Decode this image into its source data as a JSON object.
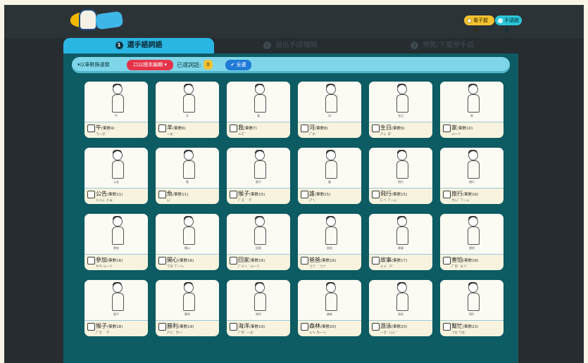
{
  "tabs": [
    {
      "num": "1",
      "label": "選手語詞語"
    },
    {
      "num": "2",
      "label": "選出手語種類"
    },
    {
      "num": "3",
      "label": "預覽/下載學手語"
    }
  ],
  "header": {
    "pill_a": "電子握手",
    "pill_b": "手語圖畫"
  },
  "filter": {
    "sort_label": "▾以筆數篩選類",
    "stroke_label": "口以總本編輯 ▾",
    "count_label": "已選詞語:",
    "count_value": "0",
    "select_all_label": "✔ 全選"
  },
  "cards": [
    {
      "caption": "牛",
      "word": "牛",
      "strokes": "(筆數4)",
      "zhuyin": "ㄋ一ㄡˊ"
    },
    {
      "caption": "羊",
      "word": "羊",
      "strokes": "(筆數6)",
      "zhuyin": "一ㄤˊ"
    },
    {
      "caption": "我",
      "word": "我",
      "strokes": "(筆數7)",
      "zhuyin": "ㄨㄛˇ"
    },
    {
      "caption": "河",
      "word": "河",
      "strokes": "(筆數8)",
      "zhuyin": "ㄏㄜˊ"
    },
    {
      "caption": "生日",
      "word": "生日",
      "strokes": "(筆數9)",
      "zhuyin": "ㄕㄥ ㄖˋ"
    },
    {
      "caption": "家",
      "word": "家",
      "strokes": "(筆數10)",
      "zhuyin": "ㄐ一ㄚ"
    },
    {
      "caption": "公告",
      "word": "公告",
      "strokes": "(筆數11)",
      "zhuyin": "ㄍㄨㄥ ㄍㄠˋ"
    },
    {
      "caption": "魚",
      "word": "魚",
      "strokes": "(筆數11)",
      "zhuyin": "ㄩˊ"
    },
    {
      "caption": "猴子",
      "word": "猴子",
      "strokes": "(筆數15)",
      "zhuyin": "ㄏㄡˊ ˙ㄗ"
    },
    {
      "caption": "誰",
      "word": "誰",
      "strokes": "(筆數15)",
      "zhuyin": "ㄕㄟˊ"
    },
    {
      "caption": "飛行",
      "word": "飛行",
      "strokes": "(筆數15)",
      "zhuyin": "ㄈㄟ ㄒ一ㄥˊ"
    },
    {
      "caption": "旅行",
      "word": "旅行",
      "strokes": "(筆數16)",
      "zhuyin": "ㄌㄩˇ ㄒ一ㄥˊ"
    },
    {
      "caption": "參加",
      "word": "參加",
      "strokes": "(筆數16)",
      "zhuyin": "ㄘㄢ ㄐ一ㄚ"
    },
    {
      "caption": "開心",
      "word": "開心",
      "strokes": "(筆數16)",
      "zhuyin": "ㄎㄞ ㄒ一ㄣ"
    },
    {
      "caption": "回家",
      "word": "回家",
      "strokes": "(筆數16)",
      "zhuyin": "ㄏㄨㄟˊ ㄐ一ㄚ"
    },
    {
      "caption": "爸爸",
      "word": "爸爸",
      "strokes": "(筆數16)",
      "zhuyin": "ㄅㄚˋ ˙ㄅㄚ"
    },
    {
      "caption": "故事",
      "word": "故事",
      "strokes": "(筆數17)",
      "zhuyin": "ㄍㄨˋ ㄕˋ"
    },
    {
      "caption": "害怕",
      "word": "害怕",
      "strokes": "(筆數18)",
      "zhuyin": "ㄏㄞˋ ㄆㄚˋ"
    },
    {
      "caption": "猴子",
      "word": "猴子",
      "strokes": "(筆數18)",
      "zhuyin": "ㄏㄡˊ ˙ㄗ"
    },
    {
      "caption": "勝利",
      "word": "勝利",
      "strokes": "(筆數19)",
      "zhuyin": "ㄕㄥˋ ㄌ一ˋ"
    },
    {
      "caption": "海洋",
      "word": "海洋",
      "strokes": "(筆數19)",
      "zhuyin": "ㄏㄞˇ 一ㄤˊ"
    },
    {
      "caption": "森林",
      "word": "森林",
      "strokes": "(筆數20)",
      "zhuyin": "ㄙㄣ ㄌ一ㄣˊ"
    },
    {
      "caption": "游泳",
      "word": "游泳",
      "strokes": "(筆數20)",
      "zhuyin": "一ㄡˊ ㄩㄥˇ"
    },
    {
      "caption": "幫忙",
      "word": "幫忙",
      "strokes": "(筆數23)",
      "zhuyin": "ㄅㄤ ㄇㄤˊ"
    }
  ]
}
